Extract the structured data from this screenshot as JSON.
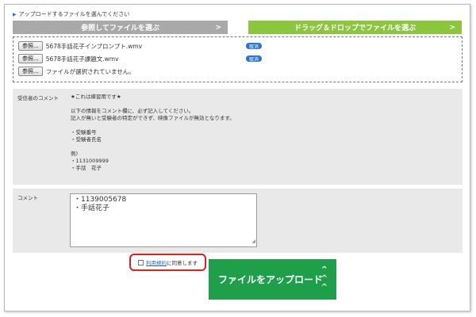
{
  "notice": "アップロードするファイルを選んでください",
  "mode_tabs": {
    "browse": "参照してファイルを選ぶ",
    "drag_drop": "ドラッグ＆ドロップでファイルを選ぶ",
    "chevron": ">"
  },
  "files": [
    {
      "button": "参照...",
      "name": "5678手話花子インプロンプト.wmv",
      "cancel": "取消"
    },
    {
      "button": "参照...",
      "name": "5678手話花子課題文.wmv",
      "cancel": "取消"
    },
    {
      "button": "参照...",
      "name": "ファイルが選択されていません。"
    }
  ],
  "recipient": {
    "label": "受信者のコメント",
    "lines": [
      "★これは練習用です★",
      "",
      "以下の情報をコメント欄に、必ず記入してください。",
      "記入が無いと受験者の特定ができず、映像ファイルが無効となります。",
      "",
      "・受験番号",
      "・受験者氏名",
      "",
      "例)",
      "・1131009999",
      "・手話　花子"
    ]
  },
  "comment": {
    "label": "コメント",
    "value_lines": [
      "・1139005678",
      "・手話花子"
    ]
  },
  "agree": {
    "link": "利用規約",
    "text": "に同意します"
  },
  "upload_button": "ファイルをアップロード",
  "colors": {
    "browse_tab": "#a9a9a9",
    "drag_drop_tab": "#8cc63f",
    "upload_button": "#1ea04a",
    "cancel_badge": "#2a73c8",
    "agree_highlight": "#e02020"
  }
}
